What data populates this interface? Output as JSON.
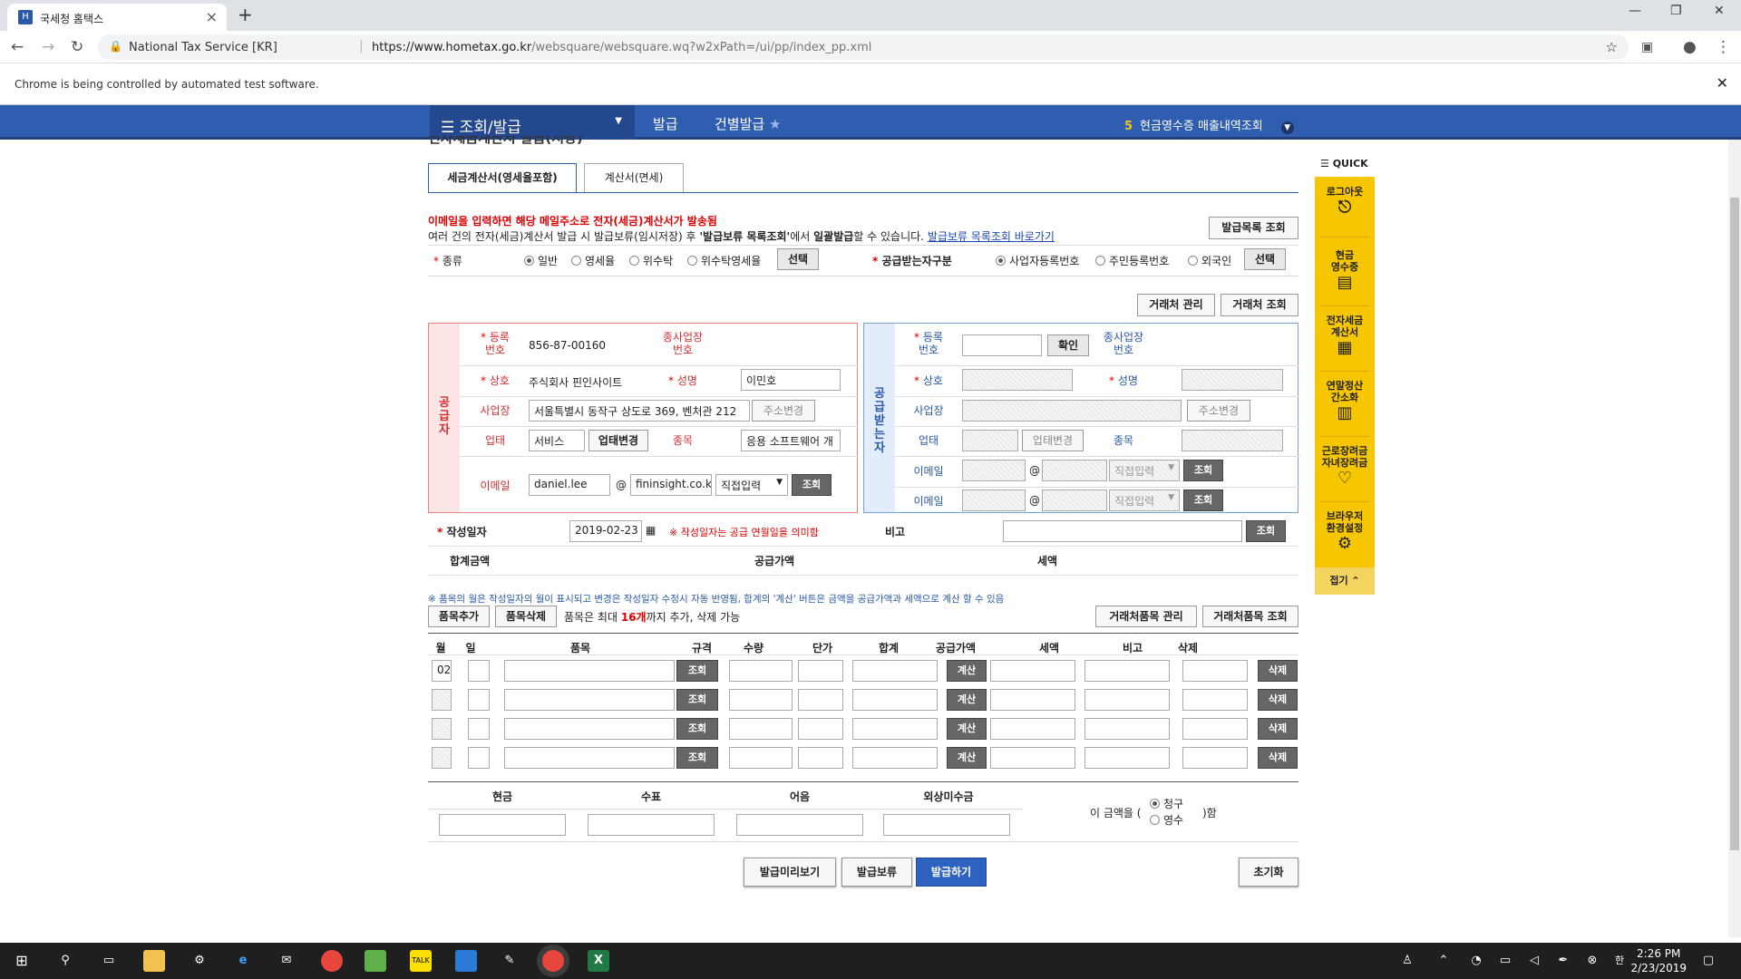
{
  "browser": {
    "tab_title": "국세청 홈택스",
    "site_label": "National Tax Service [KR]",
    "url_host": "https://www.hometax.go.kr",
    "url_path": "/websquare/websquare.wq?w2xPath=/ui/pp/index_pp.xml",
    "automation_msg": "Chrome is being controlled by automated test software."
  },
  "nav": {
    "menu_label": "조회/발급",
    "crumb1": "발급",
    "crumb2": "건별발급",
    "recent_num": "5",
    "recent_label": "현금영수증 매출내역조회",
    "page_title_cut": "전자세금계산서 발급(저장)"
  },
  "quick": {
    "header": "QUICK",
    "items": [
      "로그아웃",
      "현금\n영수증",
      "전자세금\n계산서",
      "연말정산\n간소화",
      "근로장려금\n자녀장려금",
      "브라우저\n환경설정"
    ],
    "fold": "접기"
  },
  "tabs": [
    "세금계산서(영세율포함)",
    "계산서(면세)"
  ],
  "notice": {
    "red": "이메일을 입력하면 해당 메일주소로 전자(세금)계산서가 발송됨",
    "line2a": "여러 건의 전자(세금)계산서 발급 시 발급보류(임시저장) 후 ",
    "line2b": "'발급보류 목록조회'",
    "line2c": "에서 ",
    "line2d": "일괄발급",
    "line2e": "할 수 있습니다.",
    "link": "발급보류 목록조회 바로가기",
    "list_btn": "발급목록 조회"
  },
  "type_row": {
    "label": "종류",
    "options": [
      "일반",
      "영세율",
      "위수탁",
      "위수탁영세율"
    ],
    "select": "선택",
    "recv_label": "공급받는자구분",
    "recv_options": [
      "사업자등록번호",
      "주민등록번호",
      "외국인"
    ],
    "recv_select": "선택"
  },
  "partner_btns": [
    "거래처 관리",
    "거래처 조회"
  ],
  "supplier": {
    "side": "공\n급\n자",
    "reg_label": "등록\n번호",
    "reg_value": "856-87-00160",
    "branch_label": "종사업장\n번호",
    "name_label": "상호",
    "name_value": "주식회사 핀인사이트",
    "rep_label": "성명",
    "rep_value": "이민호",
    "addr_label": "사업장",
    "addr_value": "서울특별시 동작구 상도로 369, 벤처관 212",
    "addr_btn": "주소변경",
    "biz_label": "업태",
    "biz_value": "서비스",
    "biz_btn": "업태변경",
    "item_label": "종목",
    "item_value": "응용 소프트웨어 개",
    "email_label": "이메일",
    "email_id": "daniel.lee",
    "at": "@",
    "email_domain": "fininsight.co.kr",
    "email_select": "직접입력",
    "email_btn": "조회"
  },
  "receiver": {
    "side": "공\n급\n받\n는\n자",
    "reg_label": "등록\n번호",
    "confirm": "확인",
    "branch_label": "종사업장\n번호",
    "name_label": "상호",
    "rep_label": "성명",
    "addr_label": "사업장",
    "addr_btn": "주소변경",
    "biz_label": "업태",
    "biz_btn": "업태변경",
    "item_label": "종목",
    "email_label": "이메일",
    "email_select": "직접입력",
    "email_btn": "조회"
  },
  "date_row": {
    "label": "작성일자",
    "value": "2019-02-23",
    "note": "※ 작성일자는 공급 연월일을 의미함",
    "remark": "비고",
    "remark_btn": "조회"
  },
  "sum_row": {
    "total": "합계금액",
    "supply": "공급가액",
    "tax": "세액"
  },
  "items_note": "※ 품목의 월은 작성일자의 월이 표시되고 변경은 작성일자 수정시 자동 반영됨, 합계의 '계산' 버튼은 금액을 공급가액과 세액으로 계산 할 수 있음",
  "item_btns": {
    "add": "품목추가",
    "del": "품목삭제",
    "limit_a": "품목은 최대 ",
    "limit_b": "16개",
    "limit_c": "까지 추가, 삭제 가능",
    "manage": "거래처품목 관리",
    "query": "거래처품목 조회"
  },
  "item_table": {
    "headers": [
      "월",
      "일",
      "품목",
      "규격",
      "수량",
      "단가",
      "합계",
      "공급가액",
      "세액",
      "비고",
      "삭제"
    ],
    "first_month": "02",
    "search": "조회",
    "calc": "계산",
    "delete": "삭제"
  },
  "pay": {
    "headers": [
      "현금",
      "수표",
      "어음",
      "외상미수금"
    ],
    "prefix": "이 금액을 (",
    "opt1": "청구",
    "opt2": "영수",
    "suffix": ")함"
  },
  "actions": {
    "preview": "발급미리보기",
    "hold": "발급보류",
    "issue": "발급하기",
    "reset": "초기화"
  },
  "taskbar": {
    "time": "2:26 PM",
    "date": "2/23/2019"
  },
  "colors": {
    "nav": "#2f5db0",
    "quick": "#f6c600",
    "issue_btn": "#2d62c0",
    "supplier": "#d03030",
    "receiver": "#2a5aa6"
  }
}
